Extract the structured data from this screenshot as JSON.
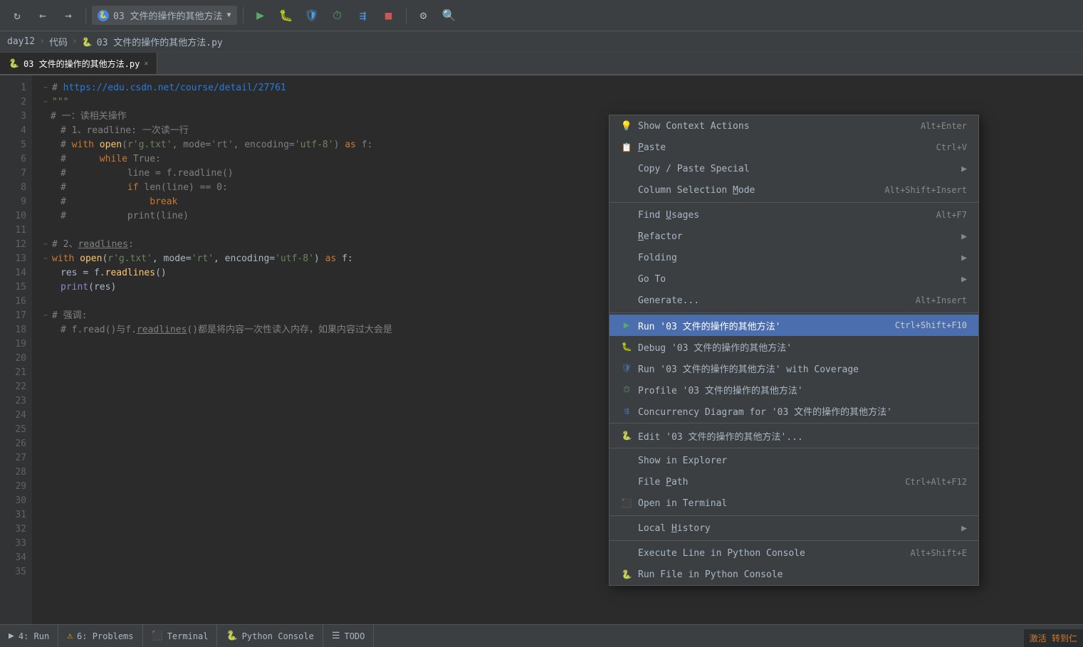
{
  "toolbar": {
    "run_config": "03 文件的操作的其他方法",
    "buttons": [
      "refresh",
      "back",
      "forward",
      "run",
      "debug",
      "coverage",
      "profile",
      "concurrency",
      "stop",
      "settings",
      "search"
    ]
  },
  "breadcrumb": {
    "items": [
      "day12",
      "代码",
      "03 文件的操作的其他方法.py"
    ]
  },
  "tab": {
    "name": "03 文件的操作的其他方法.py",
    "active": true
  },
  "code": {
    "url_line": "# https://edu.csdn.net/course/detail/27761",
    "lines": [
      {
        "num": "1",
        "content": "url"
      },
      {
        "num": "2",
        "content": "docstring"
      },
      {
        "num": "3",
        "content": "comment_1"
      },
      {
        "num": "4",
        "content": "comment_2"
      },
      {
        "num": "5",
        "content": "comment_3"
      },
      {
        "num": "6",
        "content": "comment_4"
      },
      {
        "num": "7",
        "content": "comment_5"
      },
      {
        "num": "8",
        "content": "comment_6"
      },
      {
        "num": "9",
        "content": "comment_7"
      },
      {
        "num": "10",
        "content": "comment_8"
      },
      {
        "num": "11",
        "content": "blank"
      },
      {
        "num": "12",
        "content": "comment_9"
      },
      {
        "num": "13",
        "content": "with_open"
      },
      {
        "num": "14",
        "content": "res_line"
      },
      {
        "num": "15",
        "content": "print_line"
      },
      {
        "num": "16",
        "content": "blank"
      },
      {
        "num": "17",
        "content": "comment_10"
      },
      {
        "num": "18",
        "content": "comment_11"
      }
    ]
  },
  "context_menu": {
    "items": [
      {
        "id": "show-context-actions",
        "label": "Show Context Actions",
        "shortcut": "Alt+Enter",
        "icon": "lightbulb",
        "has_arrow": false
      },
      {
        "id": "paste",
        "label": "Paste",
        "shortcut": "Ctrl+V",
        "icon": "clipboard",
        "has_arrow": false
      },
      {
        "id": "copy-paste-special",
        "label": "Copy / Paste Special",
        "shortcut": "",
        "icon": "",
        "has_arrow": true
      },
      {
        "id": "column-selection-mode",
        "label": "Column Selection Mode",
        "shortcut": "Alt+Shift+Insert",
        "icon": "",
        "has_arrow": false
      },
      {
        "id": "separator1",
        "type": "separator"
      },
      {
        "id": "find-usages",
        "label": "Find Usages",
        "shortcut": "Alt+F7",
        "icon": "",
        "has_arrow": false
      },
      {
        "id": "refactor",
        "label": "Refactor",
        "shortcut": "",
        "icon": "",
        "has_arrow": true
      },
      {
        "id": "folding",
        "label": "Folding",
        "shortcut": "",
        "icon": "",
        "has_arrow": true
      },
      {
        "id": "go-to",
        "label": "Go To",
        "shortcut": "",
        "icon": "",
        "has_arrow": true
      },
      {
        "id": "generate",
        "label": "Generate...",
        "shortcut": "Alt+Insert",
        "icon": "",
        "has_arrow": false
      },
      {
        "id": "separator2",
        "type": "separator"
      },
      {
        "id": "run",
        "label": "Run '03 文件的操作的其他方法'",
        "shortcut": "Ctrl+Shift+F10",
        "icon": "run",
        "has_arrow": false,
        "active": true
      },
      {
        "id": "debug",
        "label": "Debug '03 文件的操作的其他方法'",
        "shortcut": "",
        "icon": "debug",
        "has_arrow": false
      },
      {
        "id": "run-coverage",
        "label": "Run '03 文件的操作的其他方法' with Coverage",
        "shortcut": "",
        "icon": "coverage",
        "has_arrow": false
      },
      {
        "id": "profile",
        "label": "Profile '03 文件的操作的其他方法'",
        "shortcut": "",
        "icon": "profile",
        "has_arrow": false
      },
      {
        "id": "concurrency",
        "label": "Concurrency Diagram for '03 文件的操作的其他方法'",
        "shortcut": "",
        "icon": "concurrency",
        "has_arrow": false
      },
      {
        "id": "separator3",
        "type": "separator"
      },
      {
        "id": "edit",
        "label": "Edit '03 文件的操作的其他方法'...",
        "shortcut": "",
        "icon": "python",
        "has_arrow": false
      },
      {
        "id": "separator4",
        "type": "separator"
      },
      {
        "id": "show-explorer",
        "label": "Show in Explorer",
        "shortcut": "",
        "icon": "",
        "has_arrow": false
      },
      {
        "id": "file-path",
        "label": "File Path",
        "shortcut": "Ctrl+Alt+F12",
        "icon": "",
        "has_arrow": false
      },
      {
        "id": "open-terminal",
        "label": "Open in Terminal",
        "shortcut": "",
        "icon": "terminal",
        "has_arrow": false
      },
      {
        "id": "separator5",
        "type": "separator"
      },
      {
        "id": "local-history",
        "label": "Local History",
        "shortcut": "",
        "icon": "",
        "has_arrow": true
      },
      {
        "id": "separator6",
        "type": "separator"
      },
      {
        "id": "execute-line",
        "label": "Execute Line in Python Console",
        "shortcut": "Alt+Shift+E",
        "icon": "",
        "has_arrow": false
      },
      {
        "id": "run-python-console",
        "label": "Run File in Python Console",
        "shortcut": "",
        "icon": "python",
        "has_arrow": false
      }
    ]
  },
  "status_bar": {
    "run_label": "4: Run",
    "problems_label": "6: Problems",
    "terminal_label": "Terminal",
    "python_console_label": "Python Console",
    "todo_label": "TODO"
  },
  "watermark": "激活 转到仁"
}
